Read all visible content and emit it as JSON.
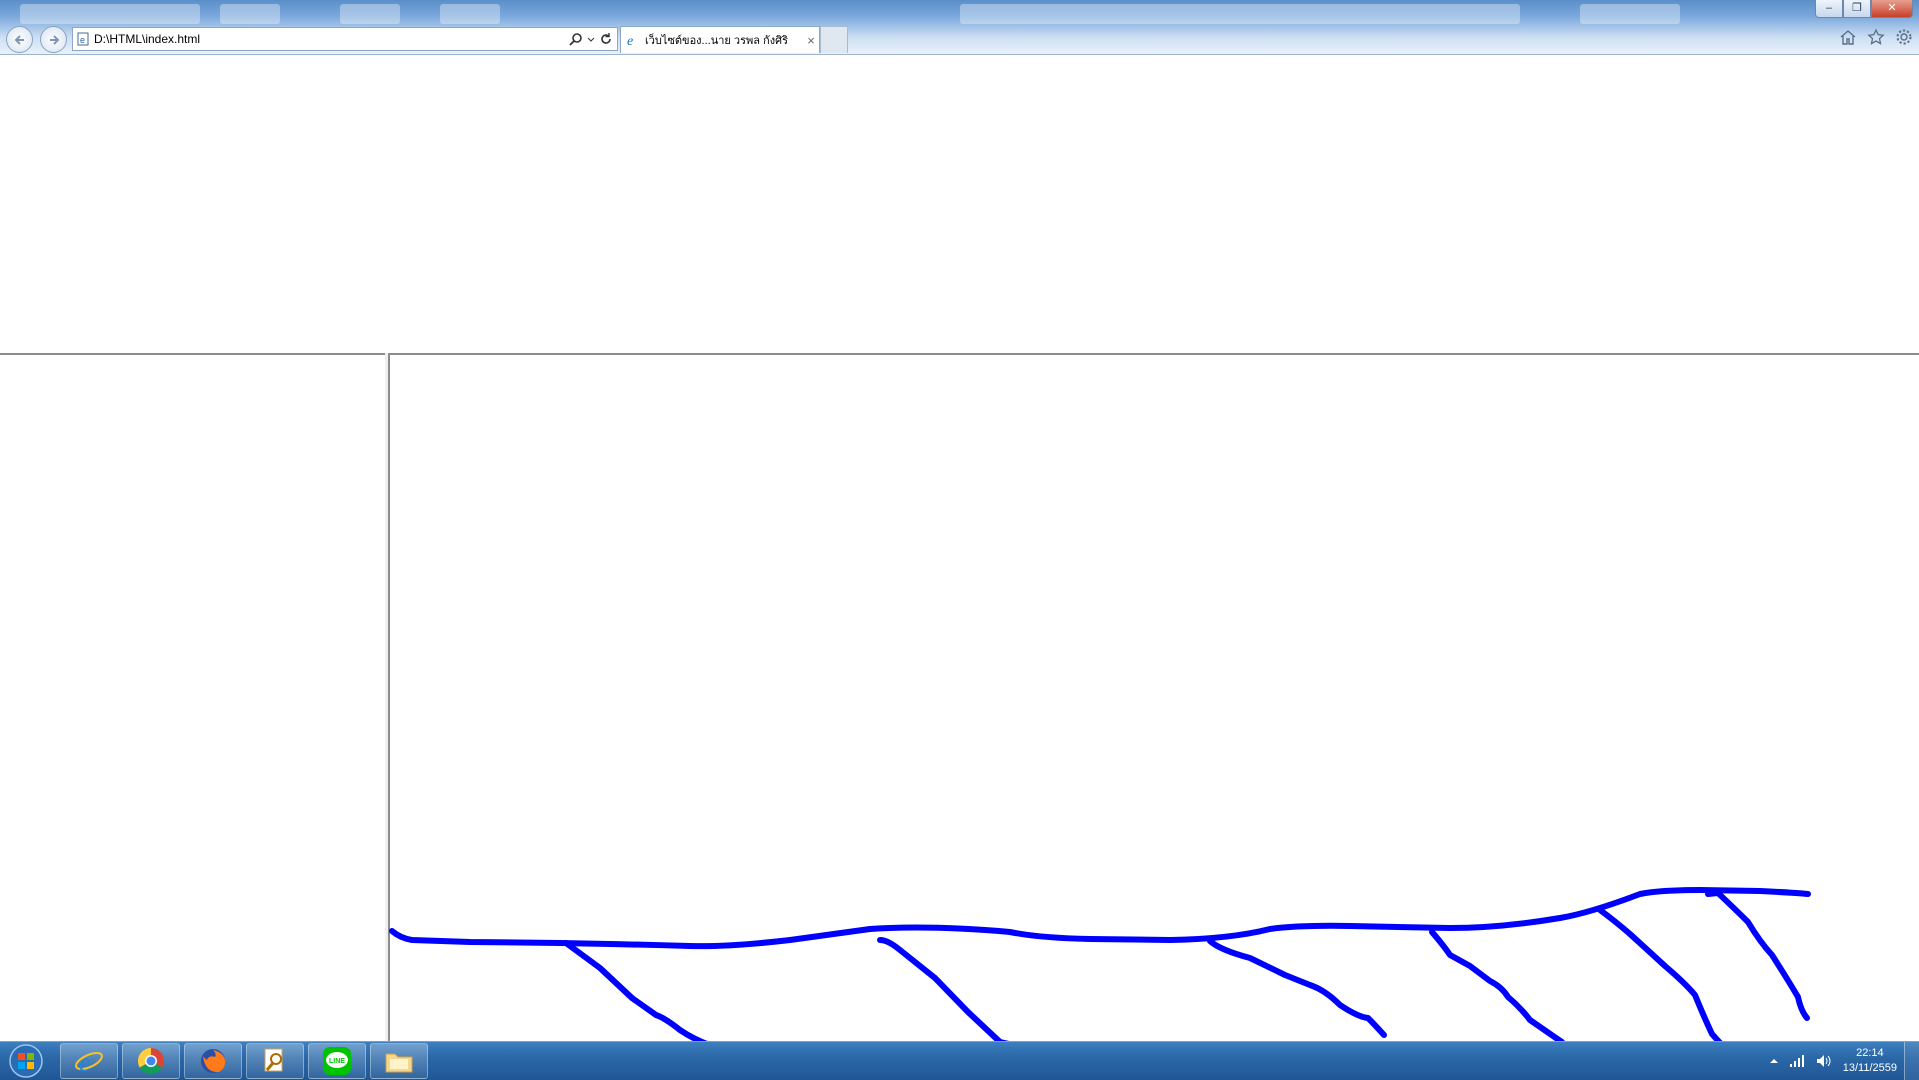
{
  "browser": {
    "address": "D:\\HTML\\index.html",
    "tab_title": "เว็บไซต์ของ...นาย วรพล กังศิริ",
    "tab_close": "×",
    "window_controls": {
      "minimize": "‒",
      "restore": "❐",
      "close": "✕"
    }
  },
  "drawing": {
    "stroke_color": "#0000ff"
  },
  "taskbar": {
    "apps": [
      "internet-explorer",
      "chrome",
      "firefox",
      "search",
      "line",
      "file-explorer"
    ],
    "clock_time": "22:14",
    "clock_date": "13/11/2559",
    "line_label": "LINE"
  }
}
